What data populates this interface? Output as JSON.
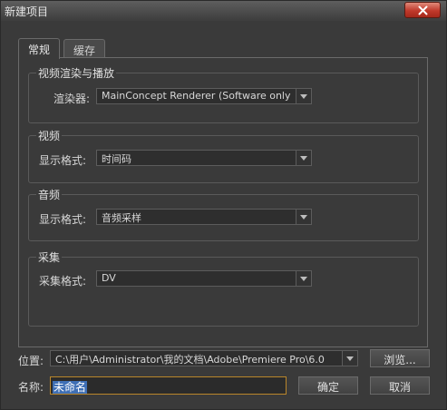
{
  "window": {
    "title": "新建项目"
  },
  "tabs": [
    {
      "label": "常规",
      "active": true
    },
    {
      "label": "缓存",
      "active": false
    }
  ],
  "groups": {
    "video_rendering": {
      "title": "视频渲染与播放",
      "renderer_label": "渲染器:",
      "renderer_value": "MainConcept Renderer (Software only)"
    },
    "video": {
      "title": "视频",
      "format_label": "显示格式:",
      "format_value": "时间码"
    },
    "audio": {
      "title": "音频",
      "format_label": "显示格式:",
      "format_value": "音频采样"
    },
    "capture": {
      "title": "采集",
      "format_label": "采集格式:",
      "format_value": "DV"
    }
  },
  "location": {
    "label": "位置:",
    "value": "C:\\用户\\Administrator\\我的文档\\Adobe\\Premiere Pro\\6.0",
    "browse_label": "浏览..."
  },
  "name": {
    "label": "名称:",
    "value": "未命名"
  },
  "actions": {
    "ok_label": "确定",
    "cancel_label": "取消"
  },
  "colors": {
    "close_button": "#c0392b",
    "input_focus_border": "#b9862b",
    "selection": "#3f6fb5"
  }
}
